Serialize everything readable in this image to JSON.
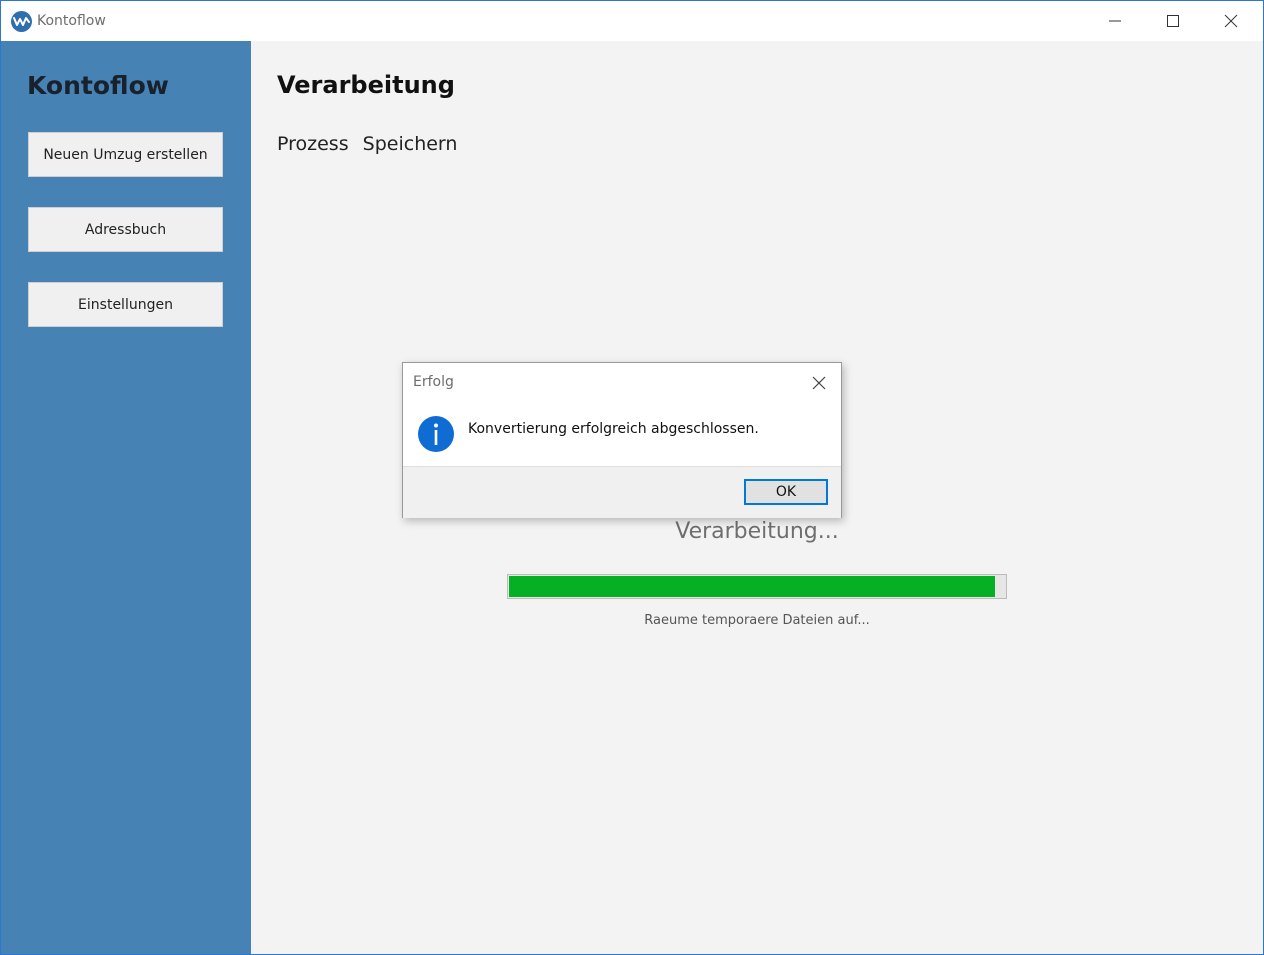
{
  "window": {
    "title": "Kontoflow"
  },
  "sidebar": {
    "title": "Kontoflow",
    "buttons": [
      {
        "label": "Neuen Umzug erstellen"
      },
      {
        "label": "Adressbuch"
      },
      {
        "label": "Einstellungen"
      }
    ]
  },
  "main": {
    "title": "Verarbeitung",
    "tabs": [
      {
        "label": "Prozess"
      },
      {
        "label": "Speichern"
      }
    ],
    "status": {
      "heading": "Verarbeitung...",
      "progress_percent": 98,
      "detail": "Raeume temporaere Dateien auf..."
    }
  },
  "dialog": {
    "title": "Erfolg",
    "message": "Konvertierung erfolgreich abgeschlossen.",
    "ok_label": "OK",
    "icon": "info-icon"
  },
  "colors": {
    "sidebar": "#4682b4",
    "progress": "#06b025",
    "accent": "#0078d7"
  }
}
